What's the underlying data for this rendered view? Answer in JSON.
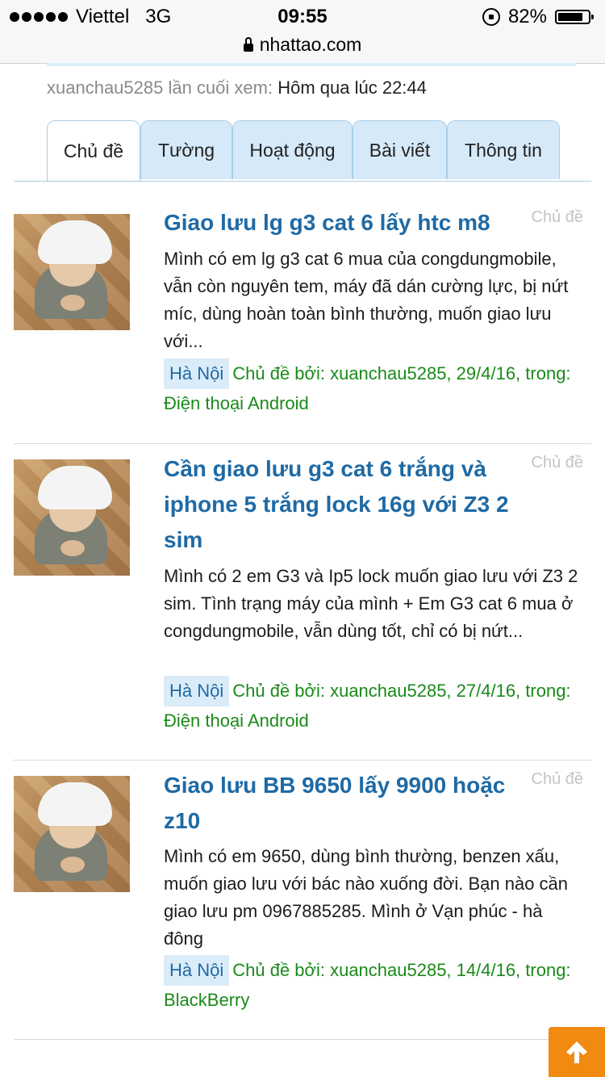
{
  "status_bar": {
    "carrier": "Viettel",
    "network": "3G",
    "time": "09:55",
    "battery": "82%",
    "battery_level": 0.82
  },
  "url_bar": {
    "domain": "nhattao.com"
  },
  "last_seen": {
    "label": "xuanchau5285 lần cuối xem:",
    "value": "Hôm qua lúc 22:44"
  },
  "tabs": [
    {
      "label": "Chủ đề",
      "active": true
    },
    {
      "label": "Tường"
    },
    {
      "label": "Hoạt động"
    },
    {
      "label": "Bài viết"
    },
    {
      "label": "Thông tin"
    }
  ],
  "threads": [
    {
      "title": "Giao lưu lg g3 cat 6 lấy htc m8",
      "type": "Chủ đề",
      "excerpt": "Mình có em lg g3 cat 6 mua của congdungmobile, vẫn còn nguyên tem, máy đã dán cường lực, bị nứt míc, dùng hoàn toàn bình thường, muốn giao lưu với...",
      "location": "Hà Nội",
      "meta": "Chủ đề bởi: xuanchau5285, 29/4/16, trong: Điện thoại Android"
    },
    {
      "title": "Cần giao lưu g3 cat 6 trắng và iphone 5 trắng lock 16g với Z3 2 sim",
      "type": "Chủ đề",
      "excerpt": "Mình có 2 em G3 và Ip5 lock muốn giao lưu với Z3 2 sim. Tình trạng máy của mình + Em G3 cat 6 mua ở congdungmobile, vẫn dùng tốt, chỉ có bị nứt...",
      "location": "Hà Nội",
      "meta": "Chủ đề bởi: xuanchau5285, 27/4/16, trong: Điện thoại Android"
    },
    {
      "title": "Giao lưu BB 9650 lấy 9900 hoặc z10",
      "type": "Chủ đề",
      "excerpt": "Mình có em 9650, dùng bình thường, benzen xấu, muốn giao lưu với bác nào xuống đời. Bạn nào cần giao lưu pm 0967885285. Mình ở Vạn phúc - hà đông",
      "location": "Hà Nội",
      "meta": "Chủ đề bởi: xuanchau5285, 14/4/16, trong: BlackBerry"
    }
  ],
  "colors": {
    "link": "#1f6aa5",
    "meta_green": "#1a8a1a",
    "tab_bg": "#d5e9f9",
    "scroll_button": "#f08a10"
  },
  "icons": {
    "scroll_top": "arrow-up-icon",
    "lock": "padlock-icon",
    "rotation_lock": "rotation-lock-icon"
  }
}
